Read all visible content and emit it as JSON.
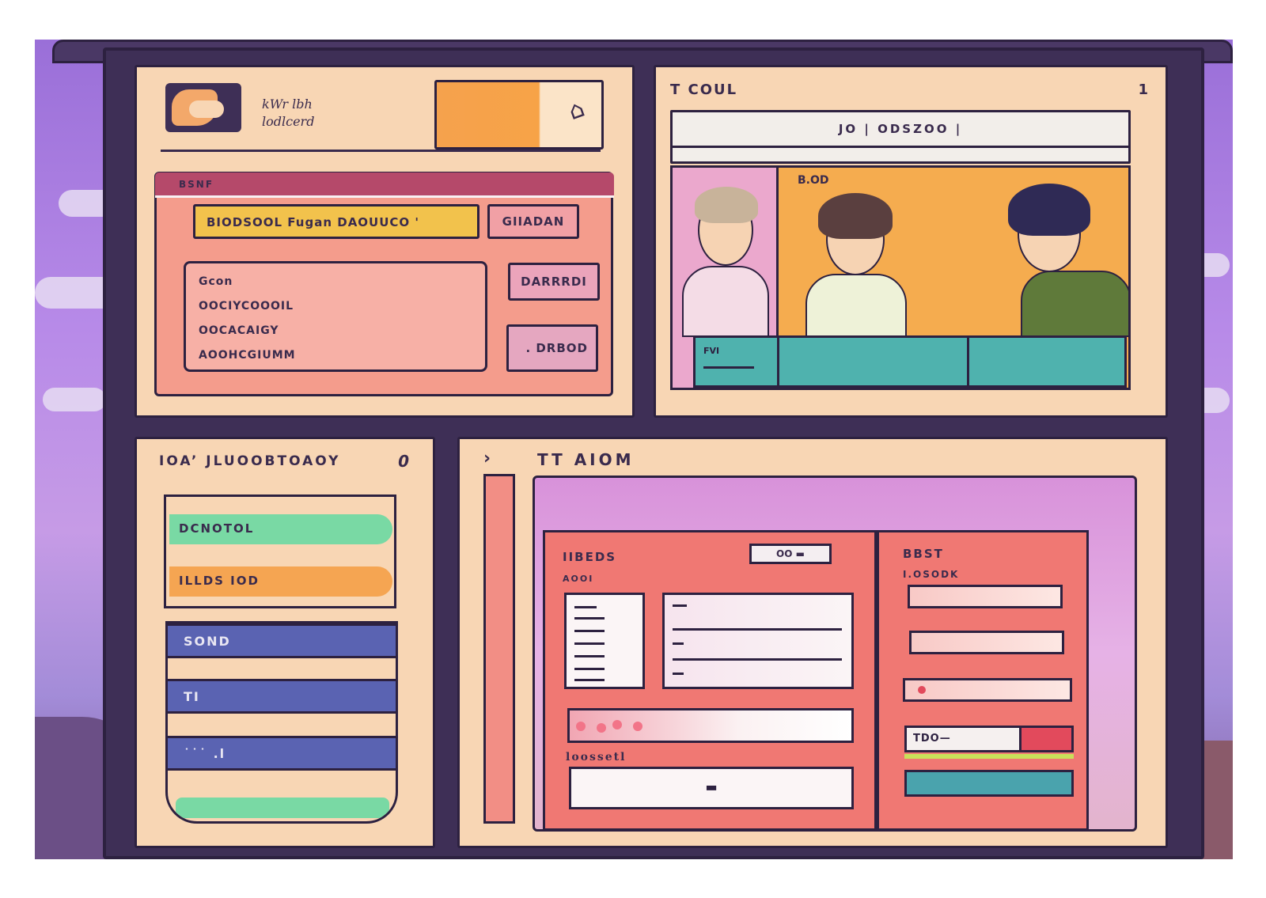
{
  "profile": {
    "name_line1": "kWr lbh",
    "name_line2": "lodlcerd",
    "header_label": "BSNF",
    "tag_bar": "BIODSOOL Fugan DAOUUCO '",
    "button_a": "GIIADAN",
    "button_b": "DARRRDI",
    "button_c": ". DRBOD",
    "list": [
      "Gcon",
      "OOCIYCOOOIL",
      "OOCACAIGY",
      "AOOHCGIUMM"
    ]
  },
  "video": {
    "title": "T COUL",
    "count": "1",
    "url": "JO | ODSZOO |",
    "overlay_label": "B.OD",
    "strip_label": "FVI"
  },
  "menu": {
    "title": "IOA’ JLUOOBTOAOY",
    "count": "0",
    "pill_green": "DCNOTOL",
    "pill_orange": "ILLDS IOD",
    "nav_items": [
      "SOND",
      "TI",
      "˙˙˙ .l"
    ]
  },
  "form": {
    "arrow": "›",
    "title": "TT AIOM",
    "left_title": "IIBEDS",
    "left_sub": "AOOI",
    "toggle_label": "OO ▬",
    "section_label": "loossetl",
    "submit_glyph": "▬",
    "right_title": "BBST",
    "right_sub": "I.OSODK",
    "toggle_text": "TDO—"
  },
  "colors": {
    "frame": "#3e2f56",
    "panel": "#f8d6b4",
    "accent_pink": "#b5496a",
    "accent_teal": "#4fb2ae",
    "accent_yellow": "#f2c24c",
    "nav_blue": "#5a63b2",
    "form_red": "#f07873"
  }
}
